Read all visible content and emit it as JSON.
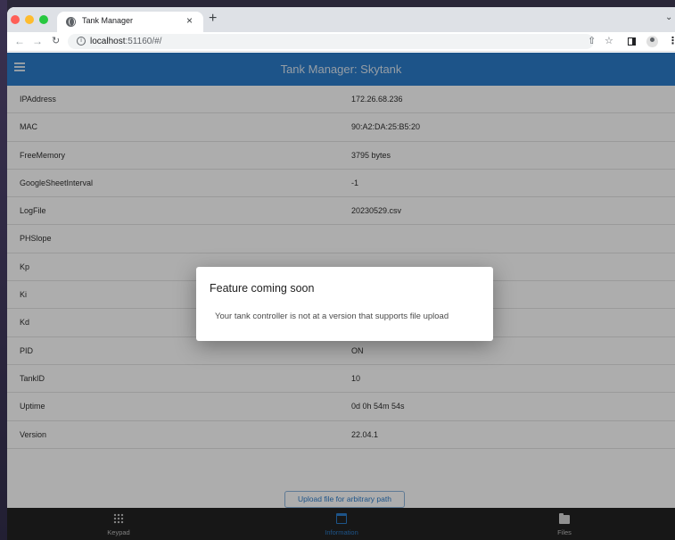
{
  "browser": {
    "tab_title": "Tank Manager",
    "tab_close": "×",
    "new_tab": "+",
    "tab_menu": "⌄",
    "url_host": "localhost",
    "url_rest": ":51160/#/",
    "icons": [
      "back-arrow-icon",
      "forward-arrow-icon",
      "reload-icon",
      "info-icon",
      "share-icon",
      "star-icon",
      "side-panel-icon",
      "profile-icon",
      "kebab-menu-icon"
    ]
  },
  "app": {
    "title": "Tank Manager: Skytank",
    "rows": [
      {
        "key": "IPAddress",
        "value": "172.26.68.236"
      },
      {
        "key": "MAC",
        "value": "90:A2:DA:25:B5:20"
      },
      {
        "key": "FreeMemory",
        "value": "3795 bytes"
      },
      {
        "key": "GoogleSheetInterval",
        "value": "-1"
      },
      {
        "key": "LogFile",
        "value": "20230529.csv"
      },
      {
        "key": "PHSlope",
        "value": ""
      },
      {
        "key": "Kp",
        "value": ""
      },
      {
        "key": "Ki",
        "value": ""
      },
      {
        "key": "Kd",
        "value": ""
      },
      {
        "key": "PID",
        "value": "ON"
      },
      {
        "key": "TankID",
        "value": "10"
      },
      {
        "key": "Uptime",
        "value": "0d 0h 54m 54s"
      },
      {
        "key": "Version",
        "value": "22.04.1"
      }
    ],
    "upload_button": "Upload file for arbitrary path",
    "bottom_nav": [
      {
        "label": "Keypad",
        "icon": "keypad-grid-icon"
      },
      {
        "label": "Information",
        "icon": "calendar-icon",
        "active": true
      },
      {
        "label": "Files",
        "icon": "folder-icon"
      }
    ],
    "accent_color": "#2c7cca"
  },
  "dialog": {
    "title": "Feature coming soon",
    "message": "Your tank controller is not at a version that supports file upload"
  }
}
